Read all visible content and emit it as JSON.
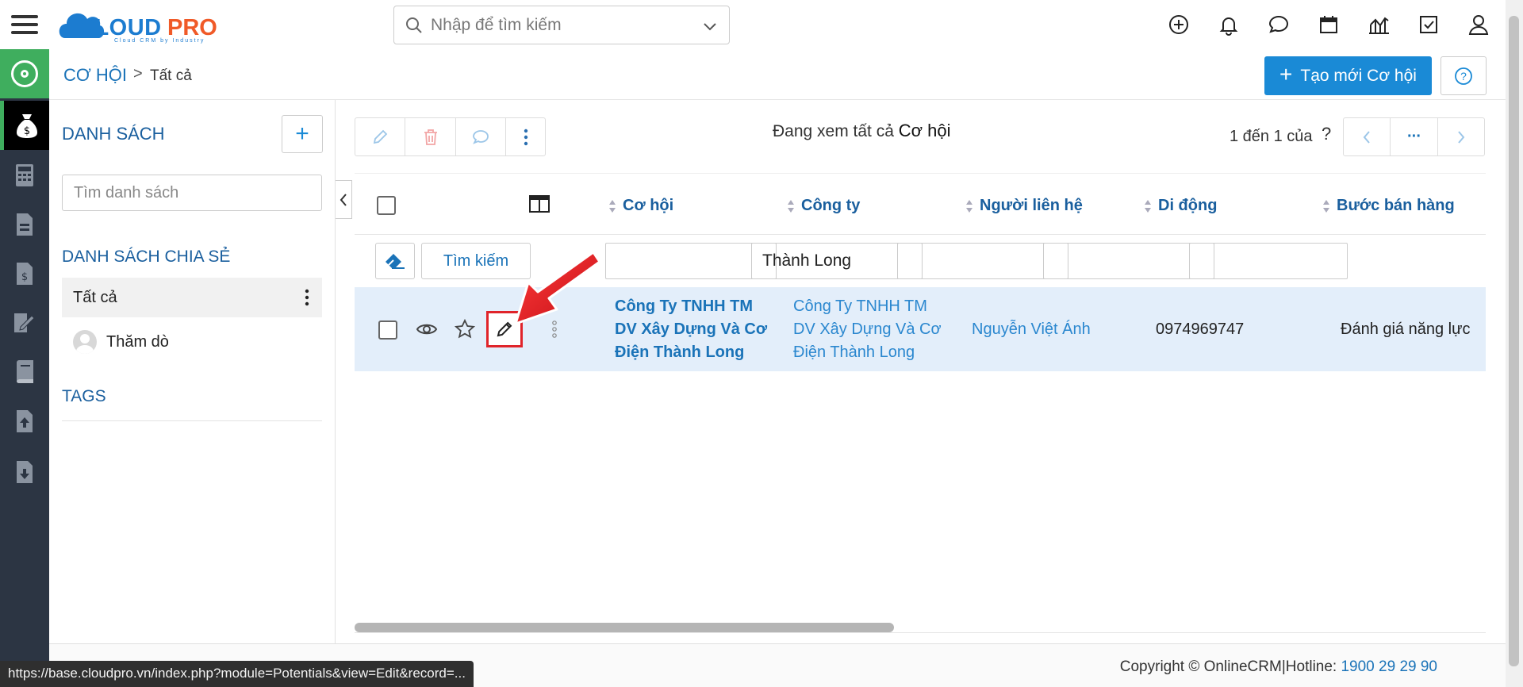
{
  "colors": {
    "accent_blue": "#1a8ad6",
    "link_blue": "#1a73b8",
    "rail_dark": "#2c3543",
    "rail_green": "#3fae5e",
    "row_highlight": "#e3eefa",
    "annotation_red": "#e0242a"
  },
  "header": {
    "logo_text": "CLOUDPRO",
    "logo_tagline": "Cloud CRM by Industry",
    "search_placeholder": "Nhập để tìm kiếm",
    "icons": [
      "plus-circle-icon",
      "bell-icon",
      "chat-icon",
      "calendar-icon",
      "report-icon",
      "task-check-icon",
      "user-icon"
    ]
  },
  "rail": {
    "icons": [
      "menu-icon",
      "module-home-icon",
      "money-bag-icon",
      "calculator-icon",
      "invoice-icon",
      "dollar-doc-icon",
      "sign-doc-icon",
      "book-icon",
      "upload-doc-icon",
      "download-doc-icon"
    ]
  },
  "breadcrumb": {
    "module": "CƠ HỘI",
    "separator": ">",
    "current": "Tất cả"
  },
  "toolbar": {
    "new_button": "Tạo mới Cơ hội",
    "new_plus": "+",
    "help": "?"
  },
  "sidebar": {
    "title": "DANH SÁCH",
    "add_label": "+",
    "search_placeholder": "Tìm danh sách",
    "shared_title": "DANH SÁCH CHIA SẺ",
    "lists": [
      {
        "label": "Tất cả"
      },
      {
        "label": "Thăm dò"
      }
    ],
    "tags_title": "TAGS"
  },
  "main": {
    "viewing_prefix": "Đang xem tất cả",
    "viewing_module": "Cơ hội",
    "pager_text": "1 đến 1 của",
    "pager_question": "?",
    "pager_more": "···",
    "columns": [
      "Cơ hội",
      "Công ty",
      "Người liên hệ",
      "Di động",
      "Bước bán hàng"
    ],
    "filter": {
      "find_button": "Tìm kiếm",
      "values": [
        "",
        "Thành Long",
        "",
        "",
        ""
      ]
    },
    "rows": [
      {
        "opportunity": [
          "Công Ty TNHH TM",
          "DV Xây Dựng Và Cơ",
          "Điện Thành Long"
        ],
        "company": [
          "Công Ty TNHH TM",
          "DV Xây Dựng Và Cơ",
          "Điện Thành Long"
        ],
        "contact": "Nguyễn Việt Ánh",
        "mobile": "0974969747",
        "sales_stage": "Đánh giá năng lực"
      }
    ]
  },
  "footer": {
    "copyright": "Copyright © OnlineCRM",
    "divider": "|",
    "hotline_label": "Hotline:",
    "hotline": "1900 29 29 90"
  },
  "status_url": "https://base.cloudpro.vn/index.php?module=Potentials&view=Edit&record=..."
}
